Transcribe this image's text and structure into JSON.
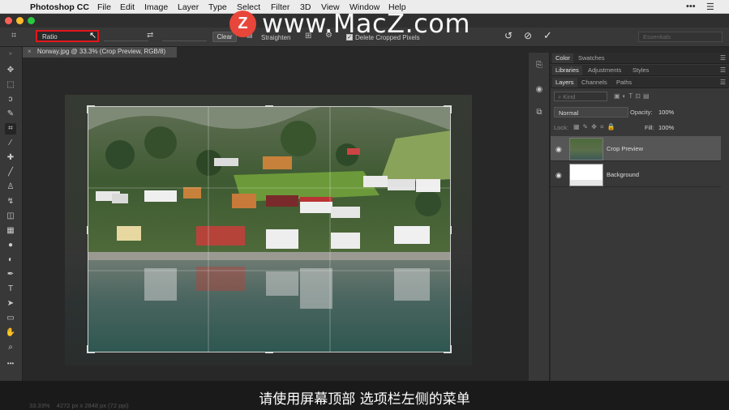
{
  "menubar": {
    "app_name": "Photoshop CC",
    "items": [
      "File",
      "Edit",
      "Image",
      "Layer",
      "Type",
      "Select",
      "Filter",
      "3D",
      "View",
      "Window",
      "Help"
    ],
    "right_icons": [
      "more-icon",
      "list-icon"
    ]
  },
  "watermark": {
    "logo_letter": "Z",
    "text": "www.MacZ.com"
  },
  "options_bar": {
    "ratio_value": "Ratio",
    "clear_label": "Clear",
    "straighten_label": "Straighten",
    "delete_cropped_label": "Delete Cropped Pixels",
    "delete_cropped_checked": true,
    "workspace_label": "Essentials"
  },
  "document": {
    "tab_title": "Norway.jpg @ 33.3% (Crop Preview, RGB/8)",
    "close_glyph": "×"
  },
  "panels": {
    "row1": {
      "tabs": [
        "Color",
        "Swatches"
      ],
      "active": "Color"
    },
    "row2": {
      "tabs": [
        "Libraries",
        "Adjustments",
        "Styles"
      ],
      "active": "Libraries"
    },
    "row3": {
      "tabs": [
        "Layers",
        "Channels",
        "Paths"
      ],
      "active": "Layers"
    },
    "kind_label": "Kind",
    "blend_mode": "Normal",
    "opacity_label": "Opacity:",
    "opacity_value": "100%",
    "lock_label": "Lock:",
    "fill_label": "Fill:",
    "fill_value": "100%",
    "layers": [
      {
        "name": "Crop Preview",
        "selected": true
      },
      {
        "name": "Background",
        "selected": false
      }
    ]
  },
  "status": {
    "zoom": "33.33%",
    "doc_size": "4272 px x 2848 px (72 ppi)"
  },
  "subtitle": "请使用屏幕顶部 选项栏左侧的菜单",
  "colors": {
    "highlight_border": "#e3171b",
    "watermark_logo": "#e8463a",
    "foreground": "#000000",
    "background": "#ffffff"
  }
}
